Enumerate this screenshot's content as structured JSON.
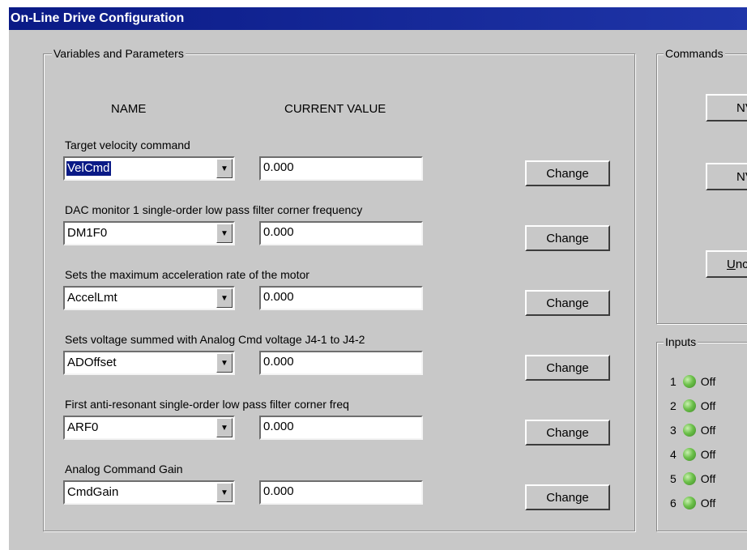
{
  "window": {
    "title": "On-Line Drive Configuration"
  },
  "variables_group": {
    "legend": "Variables and Parameters",
    "col_name": "NAME",
    "col_value": "CURRENT VALUE",
    "rows": [
      {
        "description": "Target velocity command",
        "name": "VelCmd",
        "value": "0.000",
        "button": "Change"
      },
      {
        "description": "DAC monitor 1 single-order low pass filter corner frequency",
        "name": "DM1F0",
        "value": "0.000",
        "button": "Change"
      },
      {
        "description": "Sets the maximum acceleration rate of the motor",
        "name": "AccelLmt",
        "value": "0.000",
        "button": "Change"
      },
      {
        "description": "Sets voltage summed with Analog Cmd voltage J4-1 to J4-2",
        "name": "ADOffset",
        "value": "0.000",
        "button": "Change"
      },
      {
        "description": "First anti-resonant single-order low pass filter corner freq",
        "name": "ARF0",
        "value": "0.000",
        "button": "Change"
      },
      {
        "description": "Analog Command Gain",
        "name": "CmdGain",
        "value": "0.000",
        "button": "Change"
      }
    ]
  },
  "commands_group": {
    "legend": "Commands",
    "buttons": [
      {
        "label": "NV"
      },
      {
        "label": "NV"
      },
      {
        "label": "Unc",
        "mnemonic": "U",
        "rest": "nc"
      }
    ]
  },
  "inputs_group": {
    "legend": "Inputs",
    "items": [
      {
        "number": "1",
        "state": "Off"
      },
      {
        "number": "2",
        "state": "Off"
      },
      {
        "number": "3",
        "state": "Off"
      },
      {
        "number": "4",
        "state": "Off"
      },
      {
        "number": "5",
        "state": "Off"
      },
      {
        "number": "6",
        "state": "Off"
      }
    ]
  },
  "icons": {
    "dropdown": "chevron-down-icon",
    "led": "status-led-icon"
  },
  "colors": {
    "titlebar": "#0a1a86",
    "dialog_bg": "#c8c8c8",
    "led_green": "#6cc04a",
    "selection": "#0a1a86"
  }
}
